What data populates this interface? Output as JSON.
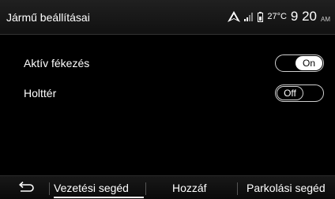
{
  "header": {
    "title": "Jármű beállításai",
    "temperature": "27°C",
    "time": "9 20",
    "ampm": "AM"
  },
  "settings": [
    {
      "label": "Aktív fékezés",
      "state": "On"
    },
    {
      "label": "Holttér",
      "state": "Off"
    }
  ],
  "tabs": [
    {
      "label": "Vezetési segéd",
      "active": true
    },
    {
      "label": "Hozzáf",
      "active": false
    },
    {
      "label": "Parkolási segéd",
      "active": false
    }
  ],
  "icons": {
    "back": "back-arrow-icon",
    "navigation": "navigation-arrow-icon",
    "signal": "signal-strength-icon",
    "battery": "battery-icon"
  }
}
